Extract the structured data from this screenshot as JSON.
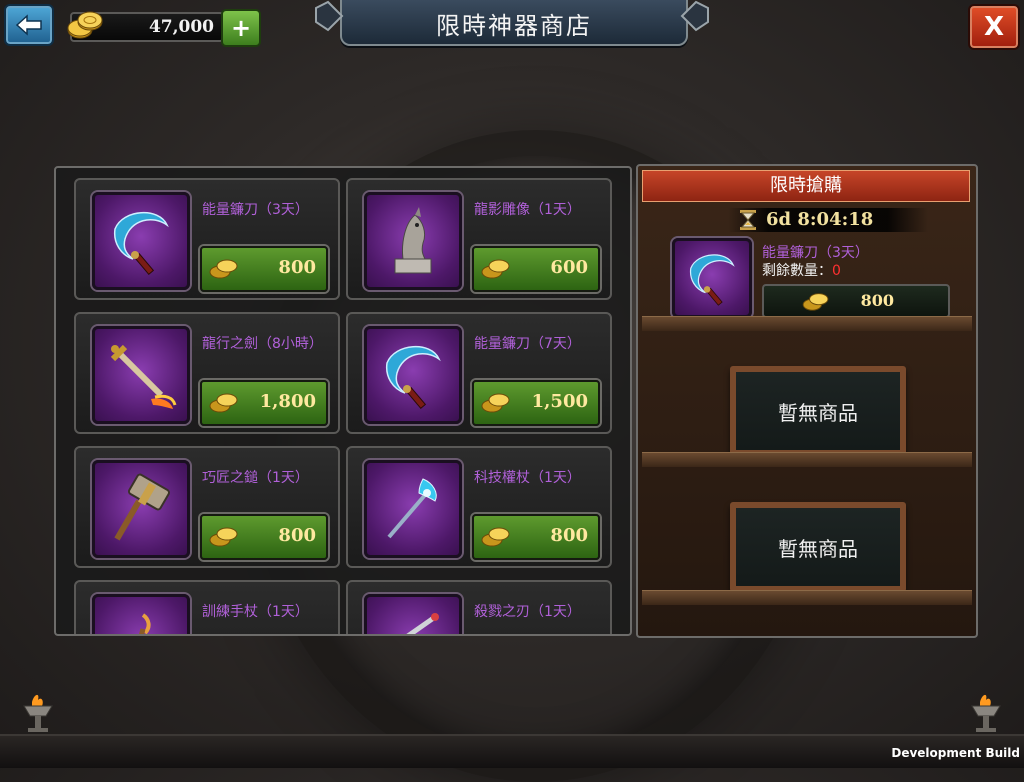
{
  "header": {
    "title": "限時神器商店",
    "currency_amount": "47,000",
    "add_label": "+",
    "close_label": "X"
  },
  "shop": {
    "items": [
      {
        "name": "能量鐮刀（3天）",
        "price": "800",
        "icon": "scythe-icon"
      },
      {
        "name": "龍影雕像（1天）",
        "price": "600",
        "icon": "dragon-statue-icon"
      },
      {
        "name": "龍行之劍（8小時）",
        "price": "1,800",
        "icon": "flame-sword-icon"
      },
      {
        "name": "能量鐮刀（7天）",
        "price": "1,500",
        "icon": "scythe-icon"
      },
      {
        "name": "巧匠之鎚（1天）",
        "price": "800",
        "icon": "hammer-icon"
      },
      {
        "name": "科技權杖（1天）",
        "price": "800",
        "icon": "scepter-icon"
      },
      {
        "name": "訓練手杖（1天）",
        "price": "",
        "icon": "staff-icon"
      },
      {
        "name": "殺戮之刃（1天）",
        "price": "",
        "icon": "blade-icon"
      }
    ]
  },
  "flash_sale": {
    "header": "限時搶購",
    "timer": "6d 8:04:18",
    "item_name": "能量鐮刀（3天）",
    "remaining_label": "剩餘數量：",
    "remaining_value": "0",
    "price": "800",
    "empty_slot_1": "暫無商品",
    "empty_slot_2": "暫無商品"
  },
  "footer": {
    "build_label": "Development Build"
  },
  "colors": {
    "item_name": "#b060d8",
    "price_button": "#4a8a24",
    "flash_header": "#c64528",
    "remaining_zero": "#ff3030"
  }
}
